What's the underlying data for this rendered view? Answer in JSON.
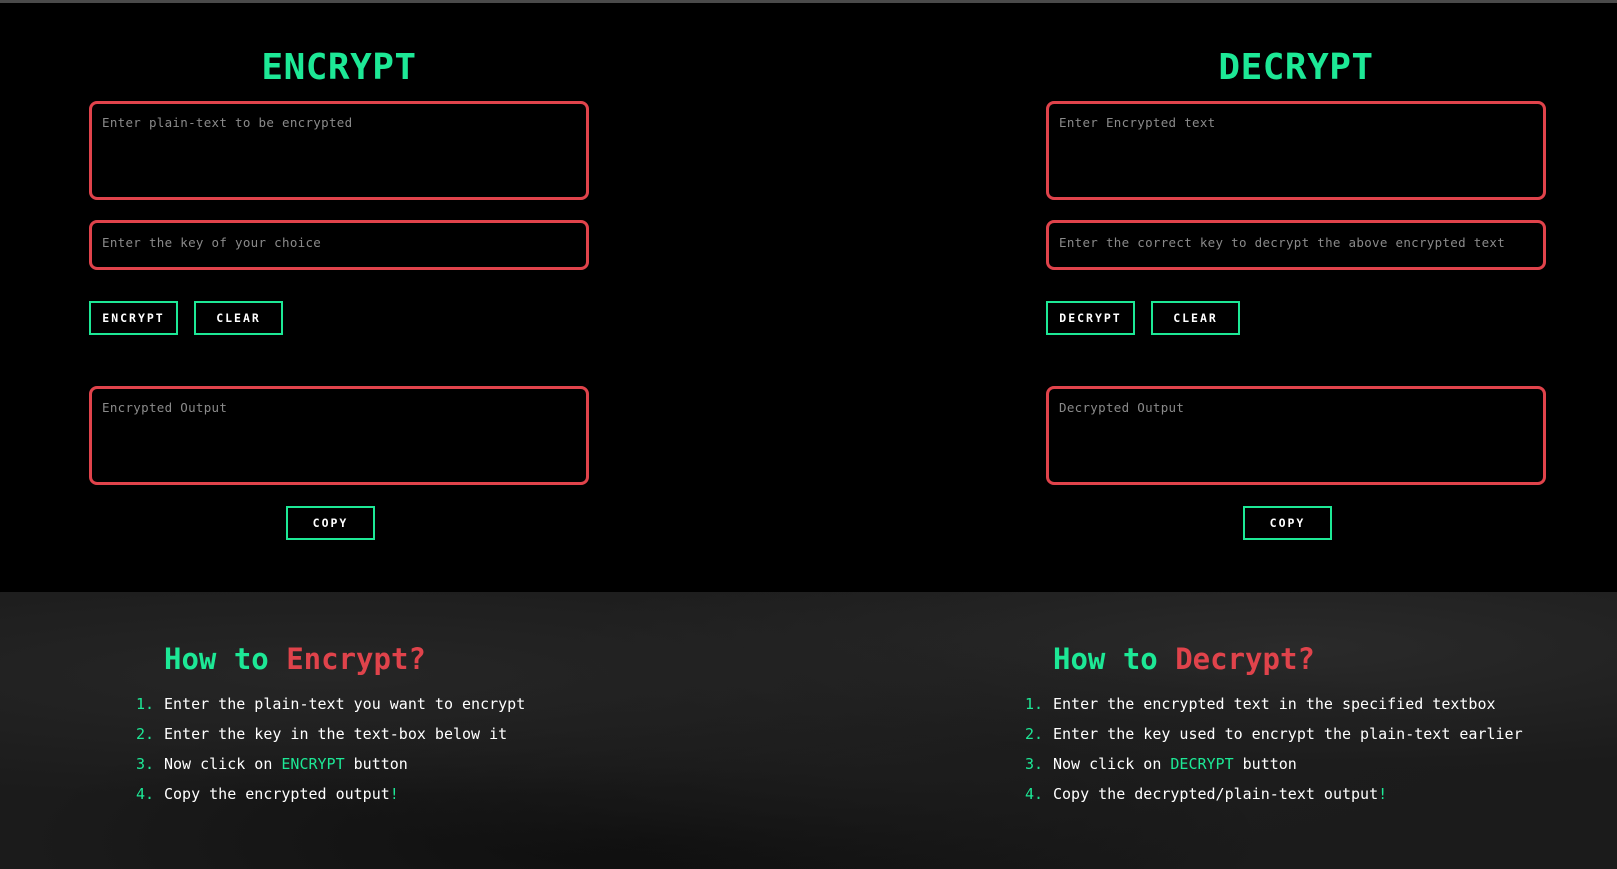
{
  "encrypt": {
    "title": "ENCRYPT",
    "text_placeholder": "Enter plain-text to be encrypted",
    "key_placeholder": "Enter the key of your choice",
    "action_label": "ENCRYPT",
    "clear_label": "CLEAR",
    "output_placeholder": "Encrypted Output",
    "copy_label": "COPY"
  },
  "decrypt": {
    "title": "DECRYPT",
    "text_placeholder": "Enter Encrypted text",
    "key_placeholder": "Enter the correct key to decrypt the above encrypted text",
    "action_label": "DECRYPT",
    "clear_label": "CLEAR",
    "output_placeholder": "Decrypted Output",
    "copy_label": "COPY"
  },
  "how_encrypt": {
    "title_prefix": "How to ",
    "title_word": "Encrypt?",
    "steps": [
      {
        "num": "1.",
        "text": "Enter the plain-text you want to encrypt"
      },
      {
        "num": "2.",
        "text": "Enter the key in the text-box below it"
      },
      {
        "num": "3.",
        "pre": "Now click on ",
        "accent": "ENCRYPT",
        "post": " button"
      },
      {
        "num": "4.",
        "text": "Copy the encrypted output",
        "mark": "!"
      }
    ]
  },
  "how_decrypt": {
    "title_prefix": "How to ",
    "title_word": "Decrypt?",
    "steps": [
      {
        "num": "1.",
        "text": "Enter the encrypted text in the specified textbox"
      },
      {
        "num": "2.",
        "text": "Enter the key used to encrypt the plain-text earlier"
      },
      {
        "num": "3.",
        "pre": "Now click on ",
        "accent": "DECRYPT",
        "post": " button"
      },
      {
        "num": "4.",
        "text": "Copy the decrypted/plain-text output",
        "mark": "!"
      }
    ]
  },
  "colors": {
    "accent_green": "#1de896",
    "border_red": "#e0434b"
  }
}
